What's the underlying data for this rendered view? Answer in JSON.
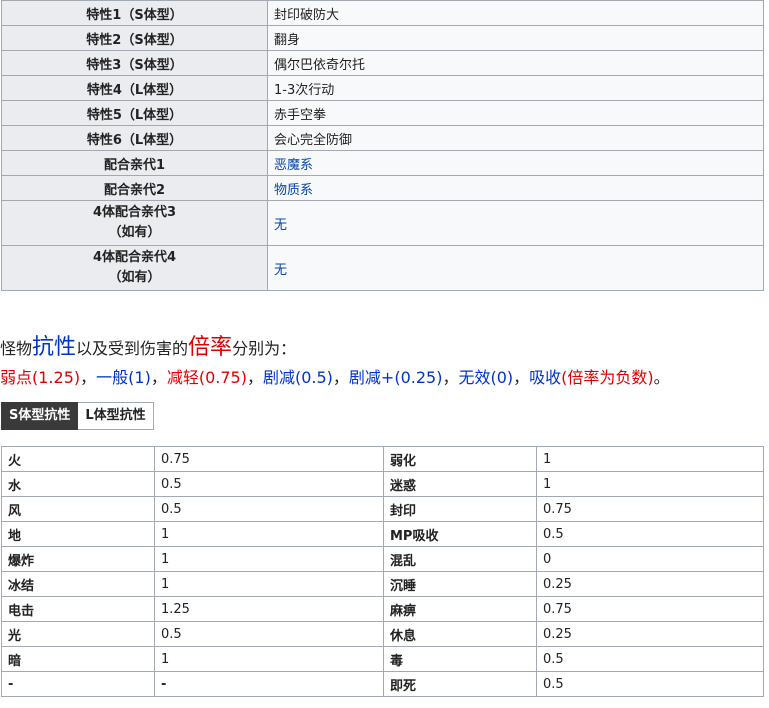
{
  "attributes": [
    {
      "label": "特性1（S体型）",
      "value": "封印破防大",
      "link": false
    },
    {
      "label": "特性2（S体型）",
      "value": "翻身",
      "link": false
    },
    {
      "label": "特性3（S体型）",
      "value": "偶尔巴依奇尔托",
      "link": false
    },
    {
      "label": "特性4（L体型）",
      "value": "1-3次行动",
      "link": false
    },
    {
      "label": "特性5（L体型）",
      "value": "赤手空拳",
      "link": false
    },
    {
      "label": "特性6（L体型）",
      "value": "会心完全防御",
      "link": false
    },
    {
      "label": "配合亲代1",
      "value": "恶魔系",
      "link": true
    },
    {
      "label": "配合亲代2",
      "value": "物质系",
      "link": true
    }
  ],
  "attributes_tall": [
    {
      "label_line1": "4体配合亲代3",
      "label_line2": "（如有）",
      "value": "无"
    },
    {
      "label_line1": "4体配合亲代4",
      "label_line2": "（如有）",
      "value": "无"
    }
  ],
  "intro": {
    "p1": "怪物",
    "p2": "抗性",
    "p3": "以及受到伤害的",
    "p4": "倍率",
    "p5": "分别为：",
    "weak": "弱点(1.25)",
    "sep1": "，",
    "normal": "一般(1)",
    "sep2": "，",
    "reduced": "减轻(0.75)",
    "sep3": "，",
    "severe": "剧减(0.5)",
    "sep4": "，",
    "severe_plus": "剧减+(0.25)",
    "sep5": "，",
    "immune": "无效(0)",
    "sep6": "，",
    "absorb": "吸收",
    "absorb_note": "(倍率为负数)",
    "end": "。"
  },
  "tabs": {
    "s": "S体型抗性",
    "l": "L体型抗性"
  },
  "resistance": [
    {
      "a": "火",
      "av": "0.75",
      "b": "弱化",
      "bv": "1"
    },
    {
      "a": "水",
      "av": "0.5",
      "b": "迷惑",
      "bv": "1"
    },
    {
      "a": "风",
      "av": "0.5",
      "b": "封印",
      "bv": "0.75"
    },
    {
      "a": "地",
      "av": "1",
      "b": "MP吸收",
      "bv": "0.5"
    },
    {
      "a": "爆炸",
      "av": "1",
      "b": "混乱",
      "bv": "0"
    },
    {
      "a": "冰结",
      "av": "1",
      "b": "沉睡",
      "bv": "0.25"
    },
    {
      "a": "电击",
      "av": "1.25",
      "b": "麻痹",
      "bv": "0.75"
    },
    {
      "a": "光",
      "av": "0.5",
      "b": "休息",
      "bv": "0.25"
    },
    {
      "a": "暗",
      "av": "1",
      "b": "毒",
      "bv": "0.5"
    },
    {
      "a": "-",
      "av": "-",
      "b": "即死",
      "bv": "0.5"
    }
  ]
}
